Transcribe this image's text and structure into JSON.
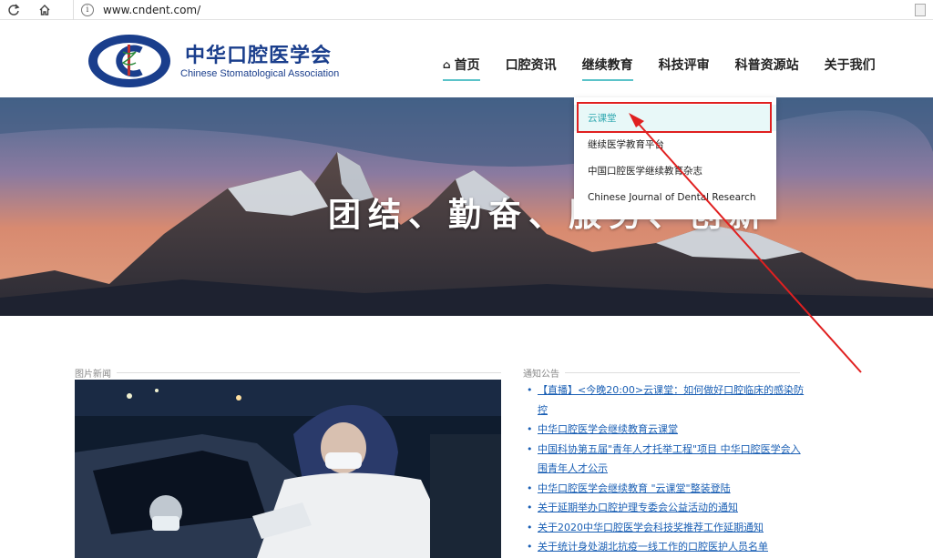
{
  "browser": {
    "url": "www.cndent.com/",
    "info_icon_glyph": "i"
  },
  "site": {
    "logo_cn": "中华口腔医学会",
    "logo_en": "Chinese Stomatological Association",
    "logo_emblem_text": "中华口腔医学会",
    "logo_emblem_sub": "Chinese Stomatological Association",
    "brand_color": "#1a3e8c",
    "accent_color": "#5bc3c9"
  },
  "nav": {
    "items": [
      {
        "label": "首页"
      },
      {
        "label": "口腔资讯"
      },
      {
        "label": "继续教育"
      },
      {
        "label": "科技评审"
      },
      {
        "label": "科普资源站"
      },
      {
        "label": "关于我们"
      }
    ]
  },
  "dropdown": {
    "items": [
      {
        "label": "云课堂"
      },
      {
        "label": "继续医学教育平台"
      },
      {
        "label": "中国口腔医学继续教育杂志"
      },
      {
        "label": "Chinese Journal of Dental Research"
      }
    ]
  },
  "hero": {
    "slogan": "团结、勤奋、服务、创新"
  },
  "sections": {
    "picture_news_title": "图片新闻",
    "notice_title": "通知公告"
  },
  "notices": [
    {
      "text": "【直播】<今晚20:00>云课堂：如何做好口腔临床的感染防控"
    },
    {
      "text": "中华口腔医学会继续教育云课堂"
    },
    {
      "text": "中国科协第五届\"青年人才托举工程\"项目 中华口腔医学会入围青年人才公示"
    },
    {
      "text": "中华口腔医学会继续教育 \"云课堂\"整装登陆"
    },
    {
      "text": "关于延期举办口腔护理专委会公益活动的通知"
    },
    {
      "text": "关于2020中华口腔医学会科技奖推荐工作延期通知"
    },
    {
      "text": "关于统计身处湖北抗疫一线工作的口腔医护人员名单"
    }
  ]
}
